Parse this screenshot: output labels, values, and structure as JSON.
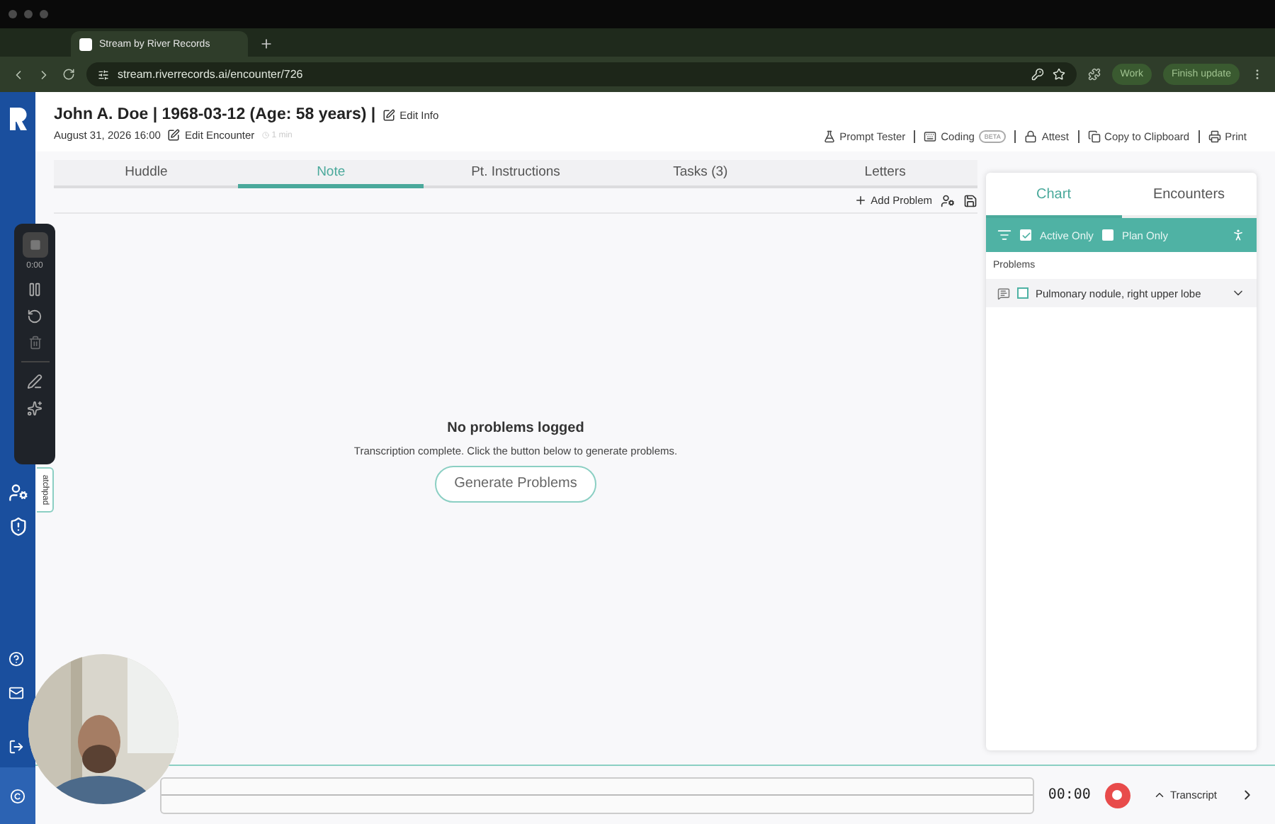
{
  "browser": {
    "tab_title": "Stream by River Records",
    "url": "stream.riverrecords.ai/encounter/726",
    "profile": "Work",
    "update_button": "Finish update"
  },
  "header": {
    "patient": "John A. Doe | 1968-03-12 (Age: 58 years) |",
    "edit_info": "Edit Info",
    "encounter_date": "August 31, 2026 16:00",
    "edit_encounter": "Edit Encounter",
    "duration": "1 min",
    "actions": [
      {
        "label": "Prompt Tester",
        "kind": "flask"
      },
      {
        "label": "Coding",
        "kind": "keyboard",
        "badge": "BETA"
      },
      {
        "label": "Attest",
        "kind": "lock"
      },
      {
        "label": "Copy to Clipboard",
        "kind": "copy"
      },
      {
        "label": "Print",
        "kind": "print"
      }
    ]
  },
  "tabs": [
    {
      "label": "Huddle",
      "selected": false
    },
    {
      "label": "Note",
      "selected": true
    },
    {
      "label": "Pt. Instructions",
      "selected": false
    },
    {
      "label": "Tasks (3)",
      "selected": false
    },
    {
      "label": "Letters",
      "selected": false
    }
  ],
  "note_toolbar": {
    "add_problem": "Add Problem"
  },
  "empty_state": {
    "title": "No problems logged",
    "message": "Transcription complete. Click the button below to generate problems.",
    "button": "Generate Problems"
  },
  "recorder": {
    "time": "0:00"
  },
  "scratchpad_tab": "atchpad",
  "side_panel": {
    "tabs": [
      {
        "label": "Chart",
        "selected": true
      },
      {
        "label": "Encounters",
        "selected": false
      }
    ],
    "filters": [
      {
        "label": "Active Only",
        "checked": true
      },
      {
        "label": "Plan Only",
        "checked": false
      }
    ],
    "section": "Problems",
    "problems": [
      {
        "label": "Pulmonary nodule, right upper lobe",
        "checked": false
      }
    ]
  },
  "bottom_bar": {
    "timer": "00:00",
    "transcript": "Transcript"
  }
}
